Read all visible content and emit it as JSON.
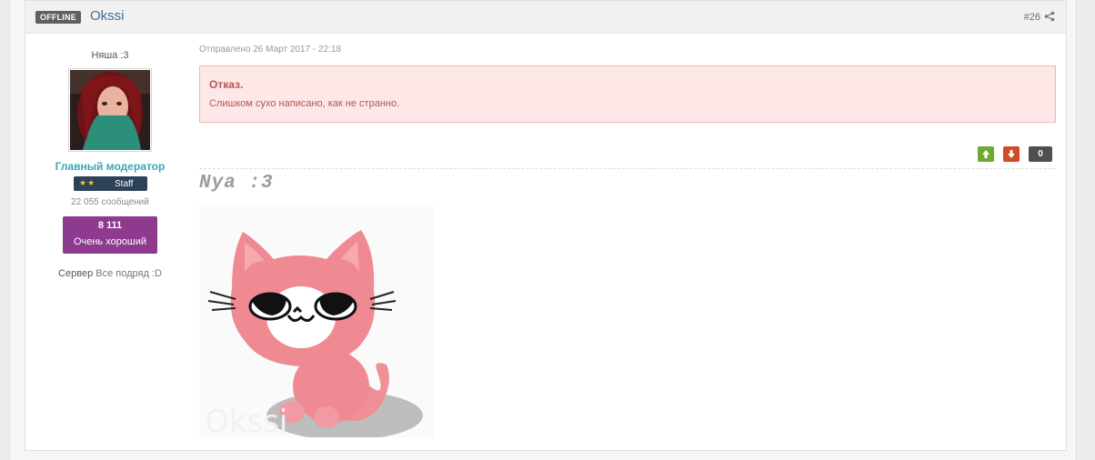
{
  "post": {
    "status": "OFFLINE",
    "author": "Okssi",
    "number": "#26",
    "date": "Отправлено 26 Март 2017 - 22:18"
  },
  "author": {
    "title": "Няша :3",
    "group": "Главный модератор",
    "rank": "Staff",
    "posts": "22 055 сообщений",
    "reputation": {
      "value": "8 111",
      "label": "Очень хороший"
    },
    "custom_field": {
      "label": "Сервер",
      "value": "Все подряд :D"
    }
  },
  "message": {
    "title": "Отказ.",
    "text": "Слишком сухо написано, как не странно."
  },
  "votes": {
    "up_icon": "arrow-up-icon",
    "down_icon": "arrow-down-icon",
    "count": "0"
  },
  "signature": {
    "text": "Nya :3",
    "watermark": "Okssi"
  },
  "colors": {
    "offline_badge": "#5f5f5f",
    "author_link": "#3f6fa0",
    "group_name": "#3aa7b4",
    "staff_badge": "#2d4158",
    "reputation_box": "#8d3a8f",
    "message_bg": "#fde7e7",
    "message_text": "#b55656",
    "vote_up": "#6fa92f",
    "vote_down": "#d24a28",
    "vote_count": "#4f4f4f"
  }
}
